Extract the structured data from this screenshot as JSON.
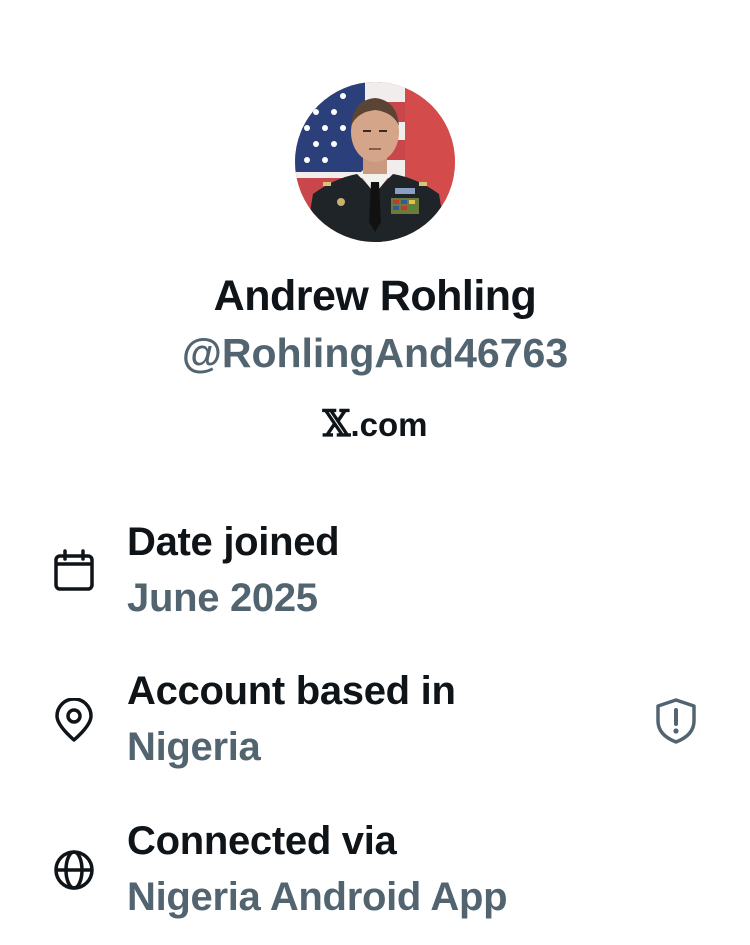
{
  "profile": {
    "name": "Andrew Rohling",
    "handle": "@RohlingAnd46763",
    "site_logo": "𝕏",
    "site_suffix": ".com",
    "avatar_icon": "profile-photo"
  },
  "details": [
    {
      "icon": "calendar-icon",
      "label": "Date joined",
      "value": "June 2025"
    },
    {
      "icon": "location-pin-icon",
      "label": "Account based in",
      "value": "Nigeria",
      "badge_icon": "shield-alert-icon"
    },
    {
      "icon": "globe-icon",
      "label": "Connected via",
      "value": "Nigeria Android App"
    }
  ],
  "colors": {
    "primary_text": "#0f1419",
    "secondary_text": "#536471",
    "background": "#ffffff"
  }
}
